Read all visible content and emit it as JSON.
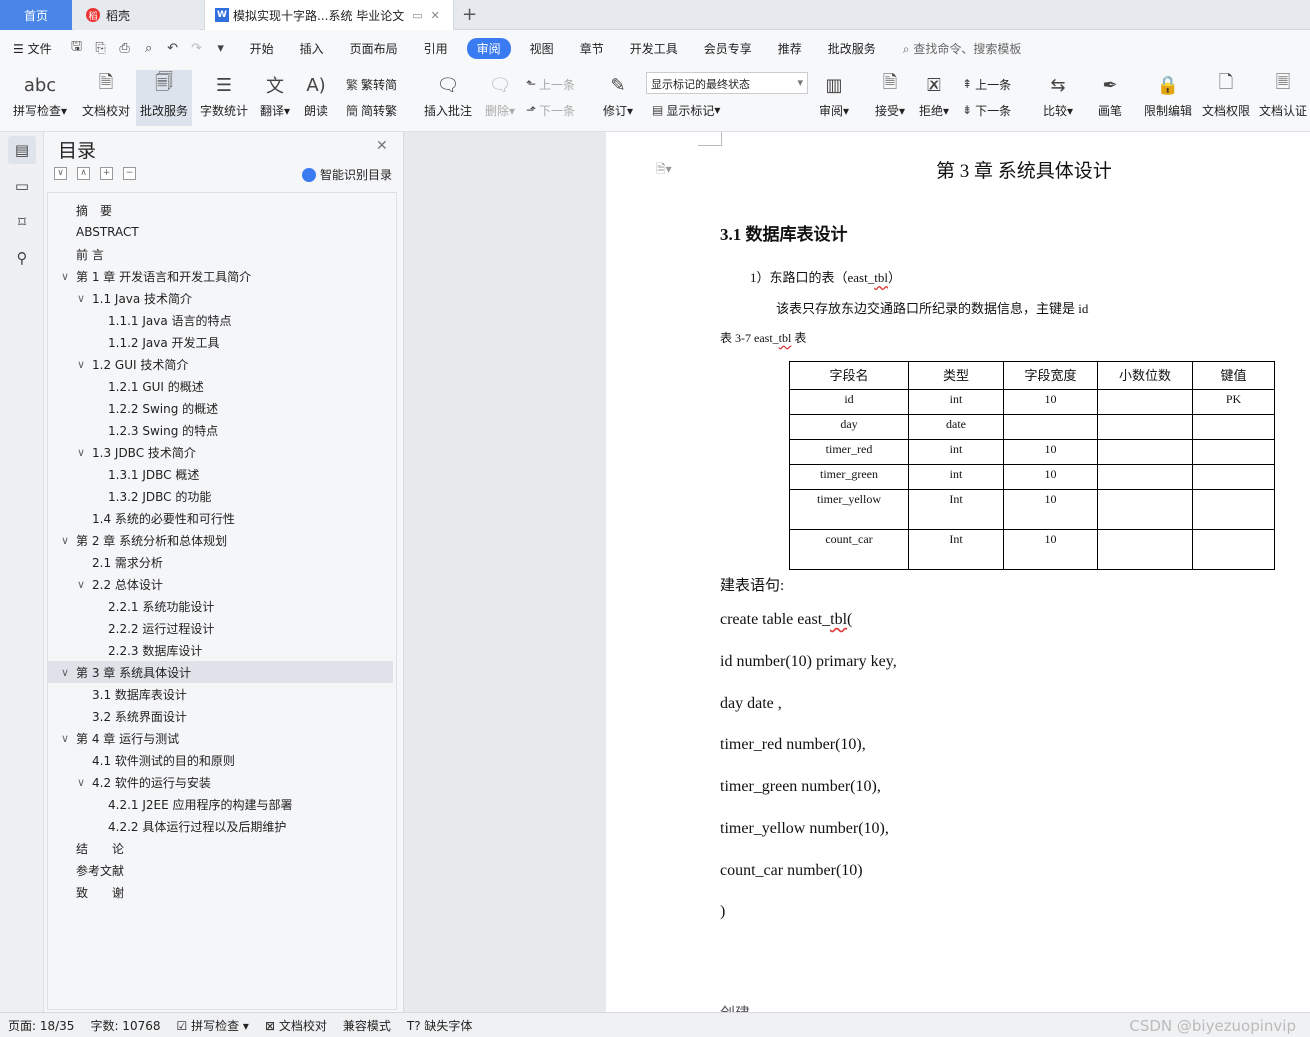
{
  "tabs": {
    "home": "首页",
    "docer": "稻壳",
    "doc": "模拟实现十字路...系统 毕业论文",
    "add": "+"
  },
  "menu": {
    "file": "文件",
    "items": [
      "开始",
      "插入",
      "页面布局",
      "引用",
      "审阅",
      "视图",
      "章节",
      "开发工具",
      "会员专享",
      "推荐",
      "批改服务"
    ],
    "active": "审阅",
    "search": "查找命令、搜索模板"
  },
  "toolbar": {
    "spellcheck": "拼写检查",
    "doc_proof": "文档校对",
    "grading": "批改服务",
    "word_count": "字数统计",
    "translate": "翻译",
    "read_aloud": "朗读",
    "trad_convert": "繁转简",
    "simp_convert": "简转繁",
    "insert_comment": "插入批注",
    "delete": "删除",
    "prev": "上一条",
    "next": "下一条",
    "revise": "修订",
    "markup_state": "显示标记的最终状态",
    "show_markup": "显示标记",
    "review": "审阅",
    "accept": "接受",
    "reject": "拒绝",
    "prev2": "上一条",
    "next2": "下一条",
    "compare": "比较",
    "pen": "画笔",
    "restrict_edit": "限制编辑",
    "doc_permission": "文档权限",
    "doc_cert": "文档认证"
  },
  "toc": {
    "title": "目录",
    "smart": "智能识别目录",
    "items": [
      {
        "text": "摘　要",
        "level": 0,
        "chev": ""
      },
      {
        "text": "ABSTRACT",
        "level": 0,
        "chev": ""
      },
      {
        "text": "前 言",
        "level": 0,
        "chev": ""
      },
      {
        "text": "第 1 章  开发语言和开发工具简介",
        "level": 0,
        "chev": "∨"
      },
      {
        "text": "1.1  Java 技术简介",
        "level": 1,
        "chev": "∨"
      },
      {
        "text": "1.1.1  Java 语言的特点",
        "level": 2,
        "chev": ""
      },
      {
        "text": "1.1.2  Java 开发工具",
        "level": 2,
        "chev": ""
      },
      {
        "text": "1.2  GUI 技术简介",
        "level": 1,
        "chev": "∨"
      },
      {
        "text": "1.2.1 GUI 的概述",
        "level": 2,
        "chev": ""
      },
      {
        "text": "1.2.2 Swing  的概述",
        "level": 2,
        "chev": ""
      },
      {
        "text": "1.2.3 Swing 的特点",
        "level": 2,
        "chev": ""
      },
      {
        "text": "1.3  JDBC 技术简介",
        "level": 1,
        "chev": "∨"
      },
      {
        "text": "1.3.1 JDBC  概述",
        "level": 2,
        "chev": ""
      },
      {
        "text": "1.3.2    JDBC 的功能",
        "level": 2,
        "chev": ""
      },
      {
        "text": "1.4  系统的必要性和可行性",
        "level": 1,
        "chev": ""
      },
      {
        "text": "第 2 章  系统分析和总体规划",
        "level": 0,
        "chev": "∨"
      },
      {
        "text": "2.1 需求分析",
        "level": 1,
        "chev": ""
      },
      {
        "text": "2.2 总体设计",
        "level": 1,
        "chev": "∨"
      },
      {
        "text": "2.2.1 系统功能设计",
        "level": 2,
        "chev": ""
      },
      {
        "text": "2.2.2 运行过程设计",
        "level": 2,
        "chev": ""
      },
      {
        "text": "2.2.3 数据库设计",
        "level": 2,
        "chev": ""
      },
      {
        "text": "第 3 章  系统具体设计",
        "level": 0,
        "chev": "∨",
        "selected": true
      },
      {
        "text": "3.1  数据库表设计",
        "level": 1,
        "chev": ""
      },
      {
        "text": "3.2  系统界面设计",
        "level": 1,
        "chev": ""
      },
      {
        "text": "第 4 章  运行与测试",
        "level": 0,
        "chev": "∨"
      },
      {
        "text": "4.1  软件测试的目的和原则",
        "level": 1,
        "chev": ""
      },
      {
        "text": "4.2  软件的运行与安装",
        "level": 1,
        "chev": "∨"
      },
      {
        "text": "4.2.1 J2EE 应用程序的构建与部署",
        "level": 2,
        "chev": ""
      },
      {
        "text": "4.2.2  具体运行过程以及后期维护",
        "level": 2,
        "chev": ""
      },
      {
        "text": "结　　论",
        "level": 0,
        "chev": ""
      },
      {
        "text": "参考文献",
        "level": 0,
        "chev": ""
      },
      {
        "text": "致　　谢",
        "level": 0,
        "chev": ""
      }
    ]
  },
  "document": {
    "chapter_title": "第 3 章  系统具体设计",
    "section_title": "3.1  数据库表设计",
    "item1_prefix": "1）东路口的表（east_",
    "item1_squiggle": "tbl",
    "item1_suffix": "）",
    "para1": "该表只存放东边交通路口所纪录的数据信息，主键是 id",
    "caption_prefix": "表 3-7 east_",
    "caption_squiggle": "tbl",
    "caption_suffix": "  表",
    "table": {
      "headers": [
        "字段名",
        "类型",
        "字段宽度",
        "小数位数",
        "键值"
      ],
      "rows": [
        [
          "id",
          "int",
          "10",
          "",
          "PK"
        ],
        [
          "day",
          "date",
          "",
          "",
          ""
        ],
        [
          "timer_red",
          "int",
          "10",
          "",
          ""
        ],
        [
          "timer_green",
          "int",
          "10",
          "",
          ""
        ],
        [
          "timer_yellow",
          "Int",
          "10",
          "",
          ""
        ],
        [
          "count_car",
          "Int",
          "10",
          "",
          ""
        ]
      ]
    },
    "sql_label": "建表语句:",
    "sql_first_prefix": "create table east_",
    "sql_first_squiggle": "tbl",
    "sql_first_suffix": "(",
    "sql_lines": [
      "id number(10) primary key,",
      "day date ,",
      "timer_red number(10),",
      "timer_green number(10),",
      "timer_yellow number(10),",
      "count_car number(10)",
      ")"
    ],
    "truncated": "创建"
  },
  "status": {
    "page": "页面: 18/35",
    "words": "字数: 10768",
    "spell": "拼写检查",
    "proof": "文档校对",
    "compat": "兼容模式",
    "missing_font": "缺失字体",
    "watermark": "CSDN @biyezuopinvip"
  }
}
